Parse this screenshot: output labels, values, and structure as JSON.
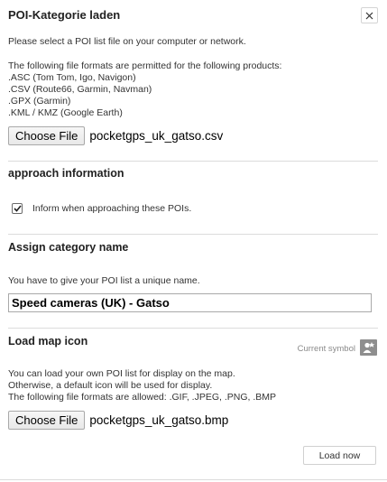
{
  "dialog": {
    "title": "POI-Kategorie laden",
    "close_icon": "close-icon"
  },
  "file_section": {
    "intro": "Please select a POI list file on your computer or network.",
    "formats_intro": "The following file formats are permitted for the following products:",
    "formats": [
      ".ASC (Tom Tom, Igo, Navigon)",
      ".CSV (Route66, Garmin, Navman)",
      ".GPX (Garmin)",
      ".KML / KMZ (Google Earth)"
    ],
    "choose_label": "Choose File",
    "file_name": "pocketgps_uk_gatso.csv"
  },
  "approach_section": {
    "title": "approach information",
    "checkbox_label": "Inform when approaching these POIs.",
    "checked": true
  },
  "category_section": {
    "title": "Assign category name",
    "hint": "You have to give your POI list a unique name.",
    "name_value": "Speed cameras (UK) - Gatso"
  },
  "icon_section": {
    "title": "Load map icon",
    "current_symbol_label": "Current symbol",
    "symbol_icon": "poi-symbol-icon",
    "lines": [
      "You can load your own POI list for display on the map.",
      "Otherwise, a default icon will be used for display.",
      "The following file formats are allowed: .GIF, .JPEG, .PNG, .BMP"
    ],
    "choose_label": "Choose File",
    "file_name": "pocketgps_uk_gatso.bmp"
  },
  "actions": {
    "load_label": "Load now"
  },
  "colors": {
    "text": "#333333",
    "divider": "#dcdcdc",
    "icon_bg": "#8e8e8e"
  }
}
